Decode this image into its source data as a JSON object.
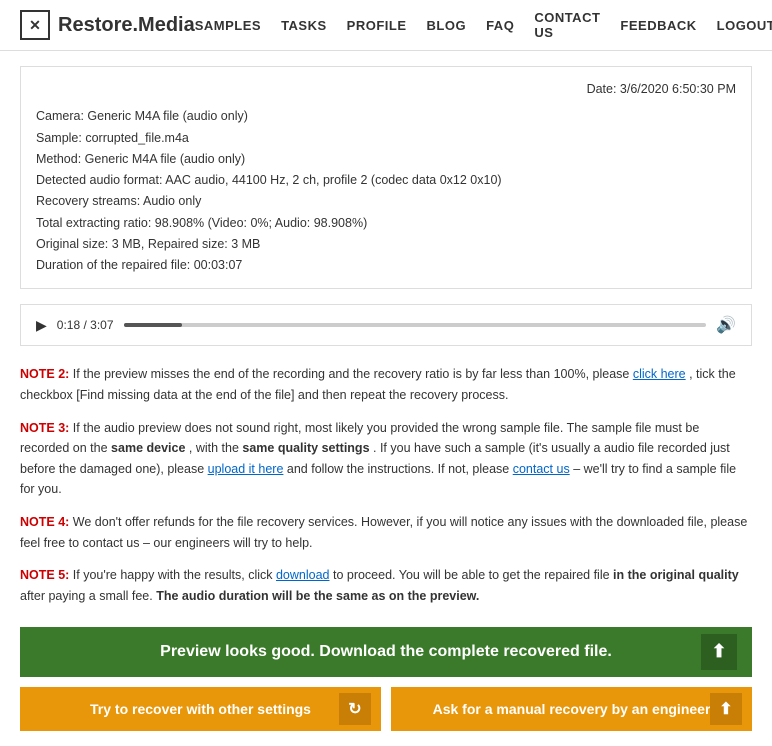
{
  "header": {
    "logo_text": "Restore.Media",
    "logo_icon": "✕",
    "nav_items": [
      {
        "label": "SAMPLES",
        "href": "#"
      },
      {
        "label": "TASKS",
        "href": "#"
      },
      {
        "label": "PROFILE",
        "href": "#"
      },
      {
        "label": "BLOG",
        "href": "#"
      },
      {
        "label": "FAQ",
        "href": "#"
      },
      {
        "label": "CONTACT US",
        "href": "#"
      },
      {
        "label": "FEEDBACK",
        "href": "#"
      },
      {
        "label": "LOGOUT",
        "href": "#"
      }
    ]
  },
  "info_box": {
    "date": "Date: 3/6/2020 6:50:30 PM",
    "lines": [
      "Camera: Generic M4A file (audio only)",
      "Sample: corrupted_file.m4a",
      "Method: Generic M4A file (audio only)",
      "Detected audio format: AAC audio, 44100 Hz, 2 ch, profile 2 (codec data 0x12 0x10)",
      "Recovery streams: Audio only",
      "Total extracting ratio: 98.908% (Video: 0%; Audio: 98.908%)",
      "Original size: 3 MB, Repaired size: 3 MB",
      "Duration of the repaired file: 00:03:07"
    ]
  },
  "audio_player": {
    "play_symbol": "▶",
    "time": "0:18 / 3:07",
    "progress_percent": 10,
    "volume_symbol": "🔊"
  },
  "notes": [
    {
      "label": "NOTE 2:",
      "text_before": " If the preview misses the end of the recording and the recovery ratio is by far less than 100%, please ",
      "link_text": "click here",
      "link_href": "#",
      "text_after": ", tick the checkbox [Find missing data at the end of the file] and then repeat the recovery process."
    },
    {
      "label": "NOTE 3:",
      "text_before": " If the audio preview does not sound right, most likely you provided the wrong sample file. The sample file must be recorded on the ",
      "bold1": "same device",
      "text_mid1": ", with the ",
      "bold2": "same quality settings",
      "text_mid2": ". If you have such a sample (it's usually a audio file recorded just before the damaged one), please ",
      "link_text": "upload it here",
      "link_href": "#",
      "text_mid3": " and follow the instructions. If not, please ",
      "link_text2": "contact us",
      "link_href2": "#",
      "text_after": " – we'll try to find a sample file for you."
    },
    {
      "label": "NOTE 4:",
      "text": " We don't offer refunds for the file recovery services. However, if you will notice any issues with the downloaded file, please feel free to contact us – our engineers will try to help."
    },
    {
      "label": "NOTE 5:",
      "text_before": " If you're happy with the results, click ",
      "link_text": "download",
      "link_href": "#",
      "text_mid": " to proceed. You will be able to get the repaired file ",
      "bold1": "in the original quality",
      "text_mid2": " after paying a small fee. ",
      "bold2": "The audio duration will be the same as on the preview."
    }
  ],
  "buttons": {
    "primary": {
      "label": "Preview looks good. Download the complete recovered file.",
      "icon": "⬆"
    },
    "secondary1": {
      "label": "Try to recover with other settings",
      "icon": "↻"
    },
    "secondary2": {
      "label": "Ask for a manual recovery by an engineer",
      "icon": "⬆"
    }
  }
}
